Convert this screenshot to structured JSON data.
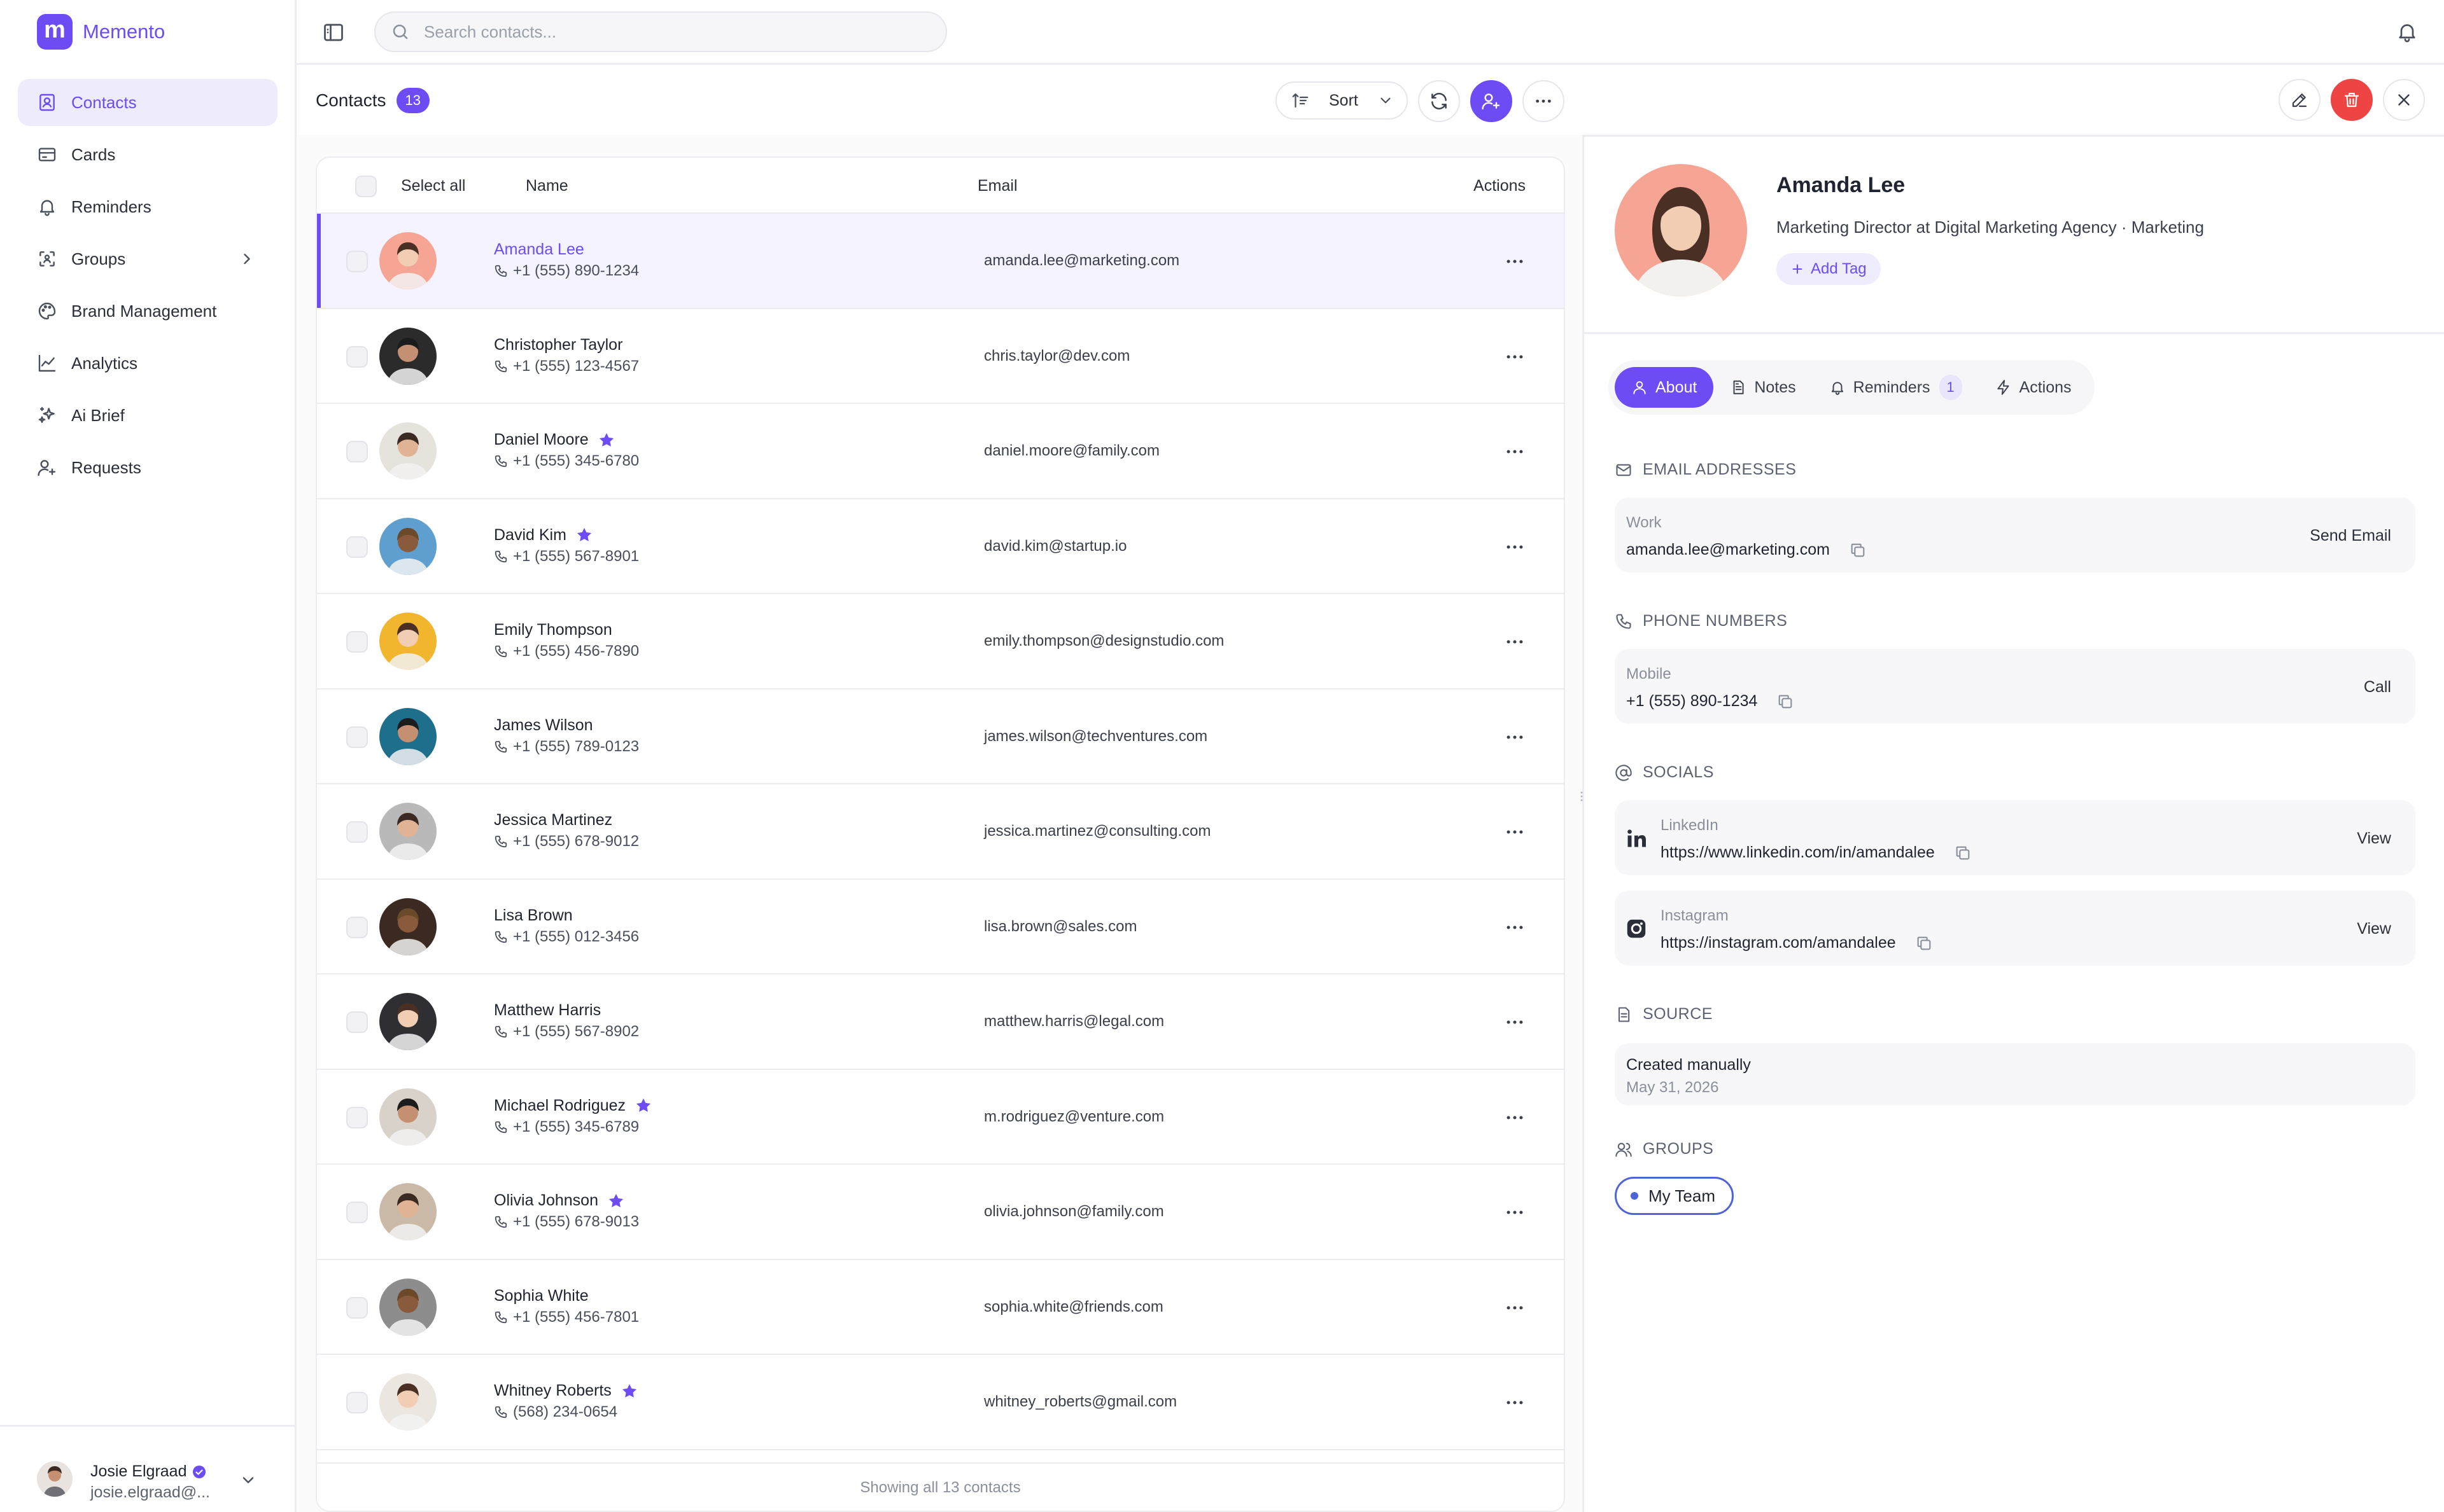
{
  "app": {
    "name": "Memento",
    "logo_letter": "m",
    "accent": "#6d4cf5",
    "danger": "#ef4444"
  },
  "sidebar": {
    "items": [
      {
        "label": "Contacts",
        "icon": "contacts-icon",
        "active": true
      },
      {
        "label": "Cards",
        "icon": "cards-icon"
      },
      {
        "label": "Reminders",
        "icon": "bell-icon"
      },
      {
        "label": "Groups",
        "icon": "groups-icon",
        "has_submenu": true
      },
      {
        "label": "Brand Management",
        "icon": "palette-icon"
      },
      {
        "label": "Analytics",
        "icon": "chart-line-icon"
      },
      {
        "label": "Ai Brief",
        "icon": "sparkles-icon"
      },
      {
        "label": "Requests",
        "icon": "user-plus-icon"
      }
    ],
    "user": {
      "name": "Josie Elgraad",
      "email": "josie.elgraad@..."
    }
  },
  "topbar": {
    "search_placeholder": "Search contacts..."
  },
  "contacts": {
    "title": "Contacts",
    "count": "13",
    "sort_label": "Sort",
    "columns": {
      "select_all": "Select all",
      "name": "Name",
      "email": "Email",
      "actions": "Actions"
    },
    "rows": [
      {
        "name": "Amanda Lee",
        "phone": "+1 (555) 890-1234",
        "email": "amanda.lee@marketing.com",
        "favorite": false,
        "selected": true,
        "avatar_bg": "#f6a494"
      },
      {
        "name": "Christopher Taylor",
        "phone": "+1 (555) 123-4567",
        "email": "chris.taylor@dev.com",
        "favorite": false,
        "avatar_bg": "#2b2b2b"
      },
      {
        "name": "Daniel Moore",
        "phone": "+1 (555) 345-6780",
        "email": "daniel.moore@family.com",
        "favorite": true,
        "avatar_bg": "#e6e2dc"
      },
      {
        "name": "David Kim",
        "phone": "+1 (555) 567-8901",
        "email": "david.kim@startup.io",
        "favorite": true,
        "avatar_bg": "#5f9fcf"
      },
      {
        "name": "Emily Thompson",
        "phone": "+1 (555) 456-7890",
        "email": "emily.thompson@designstudio.com",
        "favorite": false,
        "avatar_bg": "#f1b52e"
      },
      {
        "name": "James Wilson",
        "phone": "+1 (555) 789-0123",
        "email": "james.wilson@techventures.com",
        "favorite": false,
        "avatar_bg": "#1e6f8c"
      },
      {
        "name": "Jessica Martinez",
        "phone": "+1 (555) 678-9012",
        "email": "jessica.martinez@consulting.com",
        "favorite": false,
        "avatar_bg": "#b9b9b9"
      },
      {
        "name": "Lisa Brown",
        "phone": "+1 (555) 012-3456",
        "email": "lisa.brown@sales.com",
        "favorite": false,
        "avatar_bg": "#3b2a22"
      },
      {
        "name": "Matthew Harris",
        "phone": "+1 (555) 567-8902",
        "email": "matthew.harris@legal.com",
        "favorite": false,
        "avatar_bg": "#2f2f33"
      },
      {
        "name": "Michael Rodriguez",
        "phone": "+1 (555) 345-6789",
        "email": "m.rodriguez@venture.com",
        "favorite": true,
        "avatar_bg": "#d8d2cb"
      },
      {
        "name": "Olivia Johnson",
        "phone": "+1 (555) 678-9013",
        "email": "olivia.johnson@family.com",
        "favorite": true,
        "avatar_bg": "#cbb9a8"
      },
      {
        "name": "Sophia White",
        "phone": "+1 (555) 456-7801",
        "email": "sophia.white@friends.com",
        "favorite": false,
        "avatar_bg": "#8d8d8d"
      },
      {
        "name": "Whitney Roberts",
        "phone": "(568) 234-0654",
        "email": "whitney_roberts@gmail.com",
        "favorite": true,
        "avatar_bg": "#ece6e0"
      }
    ],
    "footer": "Showing all 13 contacts"
  },
  "detail": {
    "name": "Amanda Lee",
    "role": "Marketing Director at Digital Marketing Agency · Marketing",
    "add_tag": "Add Tag",
    "tabs": [
      {
        "label": "About",
        "icon": "user-icon",
        "active": true
      },
      {
        "label": "Notes",
        "icon": "note-icon"
      },
      {
        "label": "Reminders",
        "icon": "bell-icon",
        "count": "1"
      },
      {
        "label": "Actions",
        "icon": "zap-icon"
      }
    ],
    "sections": {
      "email": {
        "title": "EMAIL ADDRESSES",
        "label": "Work",
        "value": "amanda.lee@marketing.com",
        "action": "Send Email"
      },
      "phone": {
        "title": "PHONE NUMBERS",
        "label": "Mobile",
        "value": "+1 (555) 890-1234",
        "action": "Call"
      },
      "socials": {
        "title": "SOCIALS",
        "items": [
          {
            "label": "LinkedIn",
            "value": "https://www.linkedin.com/in/amandalee",
            "action": "View",
            "icon": "linkedin-icon"
          },
          {
            "label": "Instagram",
            "value": "https://instagram.com/amandalee",
            "action": "View",
            "icon": "instagram-icon"
          }
        ]
      },
      "source": {
        "title": "SOURCE",
        "value": "Created manually",
        "date": "May 31, 2026"
      },
      "groups": {
        "title": "GROUPS",
        "items": [
          "My Team"
        ]
      }
    }
  }
}
